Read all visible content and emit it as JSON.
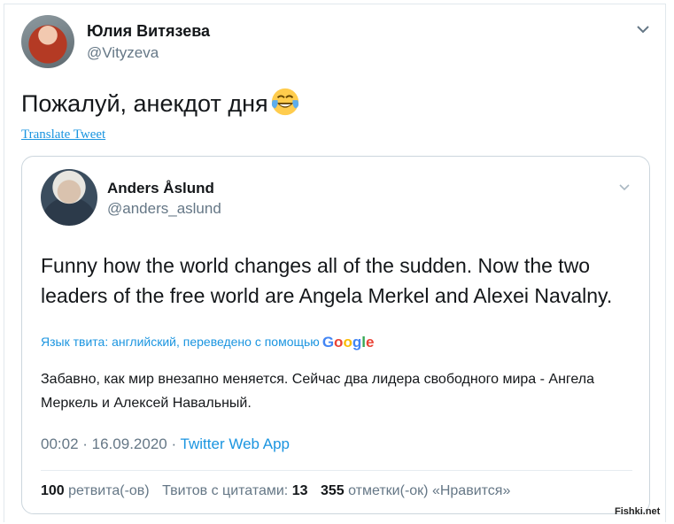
{
  "main_tweet": {
    "author_name": "Юлия Витязева",
    "author_handle": "@Vityzeva",
    "text": "Пожалуй, анекдот дня",
    "emoji_icon": "face-with-tears-of-joy-icon",
    "translate_link": "Translate Tweet"
  },
  "quoted_tweet": {
    "author_name": "Anders Åslund",
    "author_handle": "@anders_aslund",
    "text": "Funny how the world changes all of the sudden. Now the two leaders of the free world are Angela Merkel and Alexei Navalny.",
    "translation_note": "Язык твита: английский, переведено с помощью",
    "translation_provider": "Google",
    "translated_text": "Забавно, как мир внезапно меняется. Сейчас два лидера свободного мира - Ангела Меркель и Алексей Навальный.",
    "timestamp": "00:02 · 16.09.2020 · ",
    "app": "Twitter Web App",
    "stats": {
      "retweets_count": "100",
      "retweets_label": "ретвита(-ов)",
      "quotes_label": "Твитов с цитатами:",
      "quotes_count": "13",
      "likes_count": "355",
      "likes_label": "отметки(-ок) «Нравится»"
    }
  },
  "watermark": "Fishki.net",
  "colors": {
    "link": "#1b95e0",
    "secondary": "#657786",
    "border": "#ccd6dd"
  }
}
